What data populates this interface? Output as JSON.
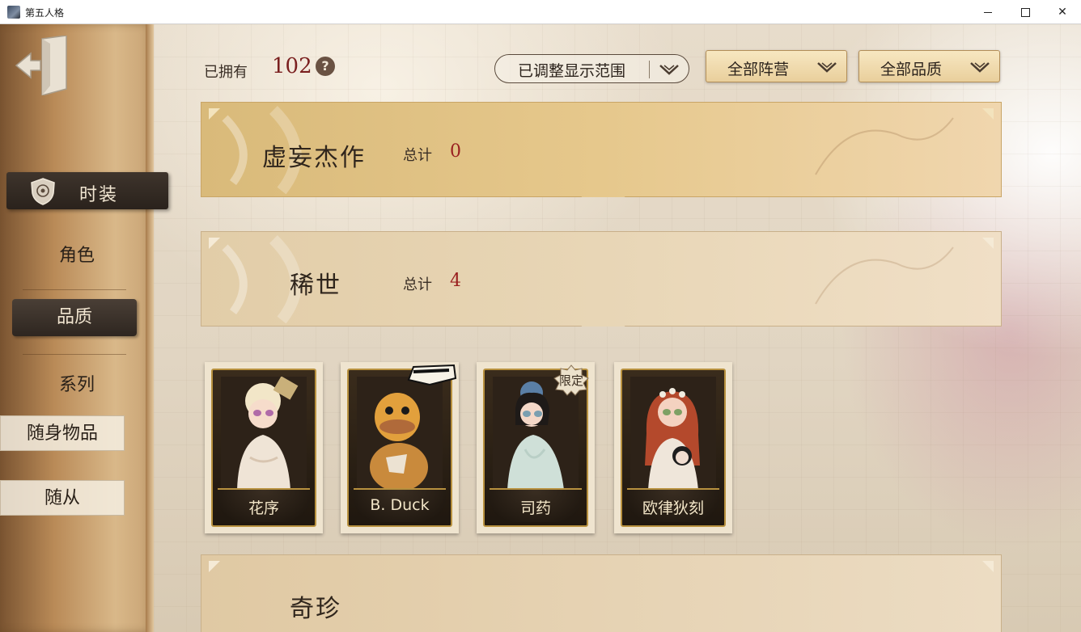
{
  "window": {
    "title": "第五人格"
  },
  "sidebar": {
    "items": [
      {
        "label": "时装"
      },
      {
        "label": "角色"
      },
      {
        "label": "品质"
      },
      {
        "label": "系列"
      },
      {
        "label": "随身物品"
      },
      {
        "label": "随从"
      }
    ]
  },
  "header": {
    "owned_label": "已拥有",
    "owned_count": "102",
    "help": "?",
    "range_dropdown": "已调整显示范围",
    "camp_dropdown": "全部阵营",
    "quality_dropdown": "全部品质"
  },
  "categories": [
    {
      "name": "虚妄杰作",
      "total_label": "总计",
      "count": "0"
    },
    {
      "name": "稀世",
      "total_label": "总计",
      "count": "4"
    },
    {
      "name": "奇珍",
      "total_label": "",
      "count": ""
    }
  ],
  "cards": [
    {
      "name": "花序",
      "badge": ""
    },
    {
      "name": "B. Duck",
      "badge": "B.DUCK"
    },
    {
      "name": "司药",
      "badge": "限定"
    },
    {
      "name": "欧律狄刻",
      "badge": ""
    }
  ],
  "colors": {
    "accent_red": "#9a2020",
    "sidebar_dark": "#2e2620",
    "gold": "#b8913f"
  }
}
